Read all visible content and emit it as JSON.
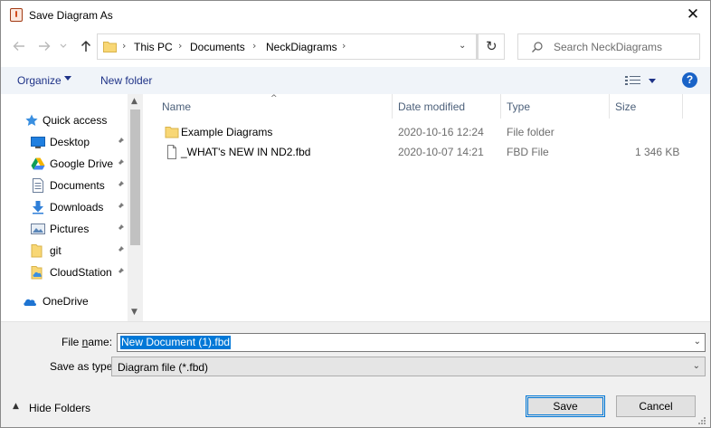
{
  "window": {
    "title": "Save Diagram As"
  },
  "address": {
    "crumbs": [
      "This PC",
      "Documents",
      "NeckDiagrams"
    ],
    "search_placeholder": "Search NeckDiagrams"
  },
  "toolbar": {
    "organize": "Organize",
    "new_folder": "New folder",
    "help": "?"
  },
  "nav": {
    "items": [
      {
        "label": "Quick access",
        "icon": "star-icon"
      },
      {
        "label": "Desktop",
        "icon": "desktop-icon",
        "pinned": true
      },
      {
        "label": "Google Drive",
        "icon": "google-drive-icon",
        "pinned": true
      },
      {
        "label": "Documents",
        "icon": "documents-icon",
        "pinned": true
      },
      {
        "label": "Downloads",
        "icon": "download-icon",
        "pinned": true
      },
      {
        "label": "Pictures",
        "icon": "pictures-icon",
        "pinned": true
      },
      {
        "label": "git",
        "icon": "folder-icon",
        "pinned": true
      },
      {
        "label": "CloudStation",
        "icon": "cloudstation-icon",
        "pinned": true
      },
      {
        "label": "OneDrive",
        "icon": "onedrive-icon"
      }
    ]
  },
  "files": {
    "columns": [
      "Name",
      "Date modified",
      "Type",
      "Size"
    ],
    "rows": [
      {
        "name": "Example Diagrams",
        "date": "2020-10-16 12:24",
        "type": "File folder",
        "size": "",
        "icon": "folder-icon"
      },
      {
        "name": "_WHAT's NEW IN ND2.fbd",
        "date": "2020-10-07 14:21",
        "type": "FBD File",
        "size": "1 346 KB",
        "icon": "file-icon"
      }
    ]
  },
  "form": {
    "file_name_label_pre": "File ",
    "file_name_label_accel": "n",
    "file_name_label_post": "ame:",
    "file_name_value": "New Document (1).fbd",
    "type_label": "Save as type:",
    "type_value": "Diagram file (*.fbd)"
  },
  "footer": {
    "hide_folders": "Hide Folders",
    "save": "Save",
    "cancel": "Cancel"
  },
  "colors": {
    "accent": "#0078d7",
    "link": "#1e3287",
    "folder": "#f8d775"
  }
}
